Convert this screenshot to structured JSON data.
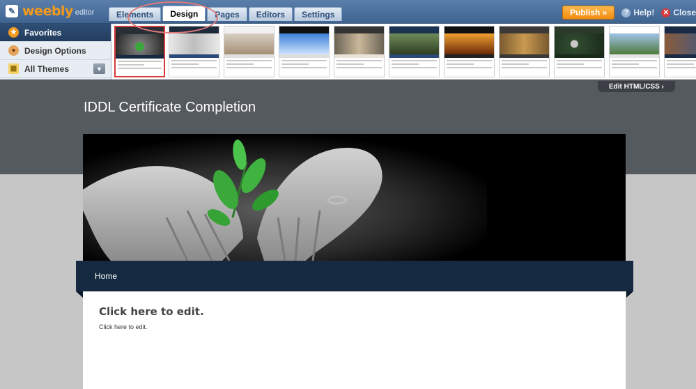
{
  "app": {
    "logo_text": "weebly",
    "logo_sub": "editor"
  },
  "tabs": [
    {
      "label": "Elements",
      "active": false
    },
    {
      "label": "Design",
      "active": true
    },
    {
      "label": "Pages",
      "active": false
    },
    {
      "label": "Editors",
      "active": false
    },
    {
      "label": "Settings",
      "active": false
    }
  ],
  "top_right": {
    "publish_label": "Publish »",
    "help_label": "Help!",
    "close_label": "Close"
  },
  "left_panel": {
    "items": [
      {
        "label": "Favorites",
        "icon": "star-icon",
        "active": true
      },
      {
        "label": "Design Options",
        "icon": "palette-icon",
        "active": false
      },
      {
        "label": "All Themes",
        "icon": "grid-icon",
        "active": false
      }
    ]
  },
  "theme_thumbnails": {
    "count": 11,
    "selected_index": 0
  },
  "editor": {
    "edit_html_label": "Edit HTML/CSS ›",
    "site_title": "IDDL Certificate Completion",
    "nav_home": "Home",
    "content_heading": "Click here to edit.",
    "content_body": "Click here to edit."
  },
  "colors": {
    "topbar": "#4a6f9c",
    "publish": "#f39a1e",
    "nav_bar": "#152a40",
    "dark_band": "#555a5f",
    "leaf": "#3aa83a"
  }
}
